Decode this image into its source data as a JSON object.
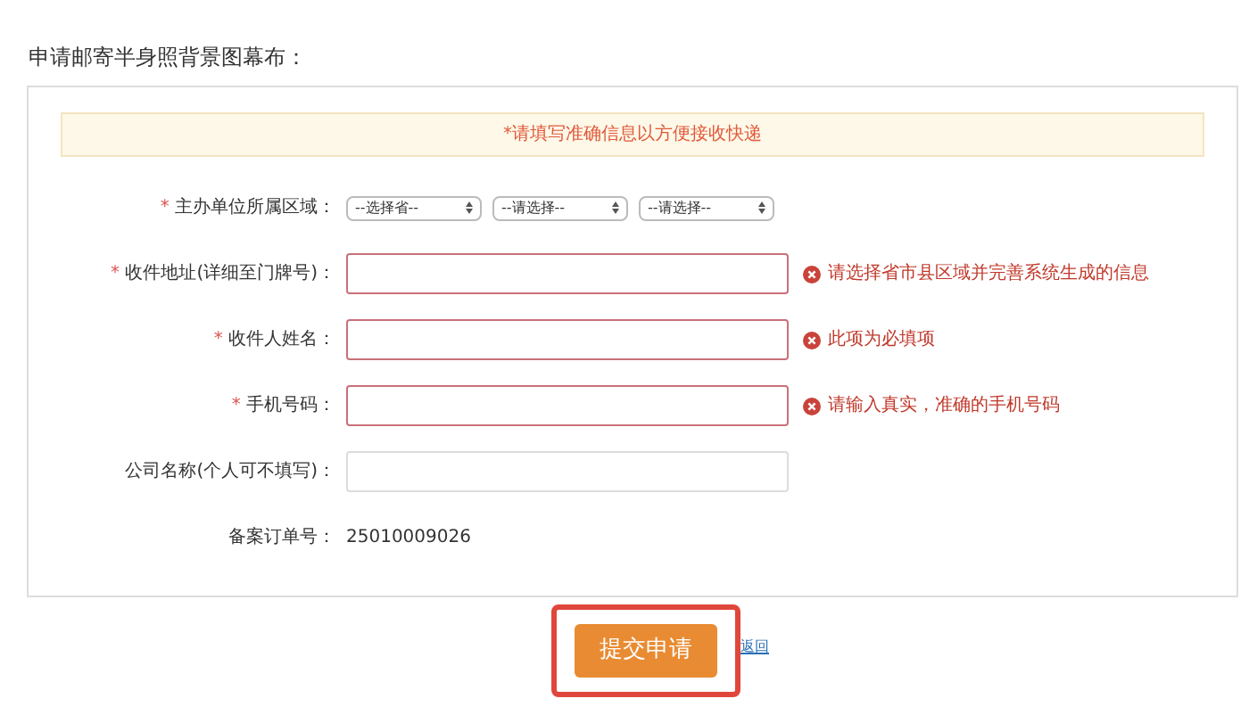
{
  "title": "申请邮寄半身照背景图幕布：",
  "notice": "*请填写准确信息以方便接收快递",
  "fields": [
    {
      "kind": "selects",
      "label": "主办单位所属区域：",
      "required_mark": "*",
      "options": [
        "--选择省--",
        "--请选择--",
        "--请选择--"
      ]
    },
    {
      "kind": "input",
      "label": "收件地址(详细至门牌号)：",
      "required_mark": "*",
      "invalid": true,
      "error": "请选择省市县区域并完善系统生成的信息"
    },
    {
      "kind": "input",
      "label": "收件人姓名：",
      "required_mark": "*",
      "invalid": true,
      "error": "此项为必填项"
    },
    {
      "kind": "input",
      "label": "手机号码：",
      "required_mark": "*",
      "invalid": true,
      "error": "请输入真实，准确的手机号码"
    },
    {
      "kind": "input",
      "label": "公司名称(个人可不填写)：",
      "invalid": false
    },
    {
      "kind": "text",
      "label": "备案订单号：",
      "value": "25010009026"
    }
  ],
  "submit": {
    "label": "提交申请",
    "highlighted": true
  },
  "back_link": "返回"
}
